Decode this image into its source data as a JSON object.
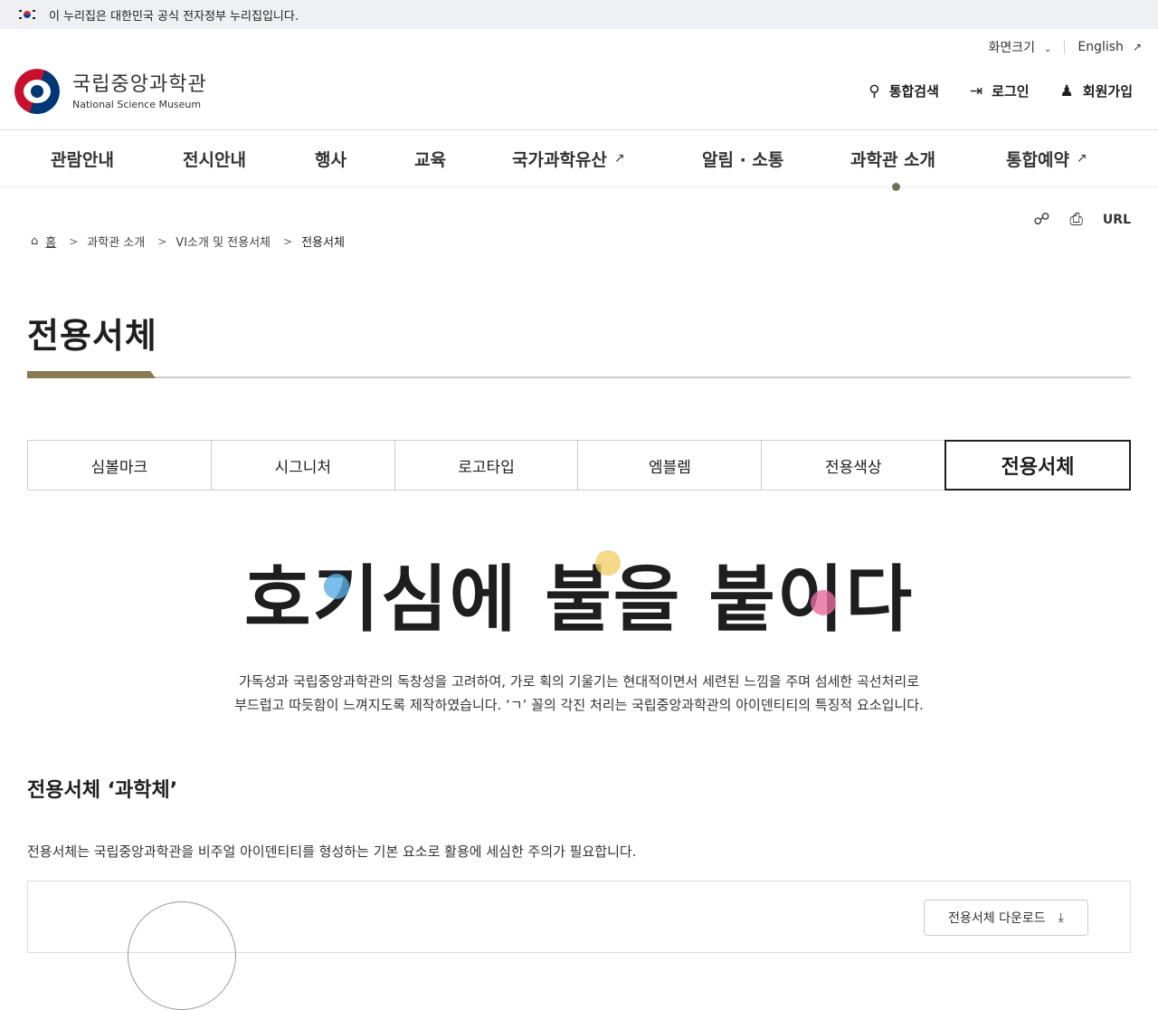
{
  "gov_banner": {
    "text": "이 누리집은 대한민국 공식 전자정부 누리집입니다."
  },
  "utility": {
    "font_size": "화면크기",
    "english": "English"
  },
  "logo": {
    "ko": "국립중앙과학관",
    "en": "National Science Museum"
  },
  "header_actions": {
    "search": "통합검색",
    "login": "로그인",
    "signup": "회원가입"
  },
  "nav": {
    "items": [
      {
        "label": "관람안내"
      },
      {
        "label": "전시안내"
      },
      {
        "label": "행사"
      },
      {
        "label": "교육"
      },
      {
        "label": "국가과학유산"
      },
      {
        "label": "알림 · 소통"
      },
      {
        "label": "과학관 소개"
      },
      {
        "label": "통합예약"
      }
    ]
  },
  "breadcrumb": {
    "home": "홈",
    "level1": "과학관 소개",
    "level2": "VI소개 및 전용서체",
    "current": "전용서체"
  },
  "tools": {
    "url": "URL"
  },
  "page_title": "전용서체",
  "tabs": [
    {
      "label": "심볼마크"
    },
    {
      "label": "시그니처"
    },
    {
      "label": "로고타입"
    },
    {
      "label": "엠블렘"
    },
    {
      "label": "전용색상"
    },
    {
      "label": "전용서체"
    }
  ],
  "slogan": "호기심에 불을 붙이다",
  "description": {
    "line1": "가독성과 국립중앙과학관의 독창성을 고려하여, 가로 획의 기울기는 현대적이면서 세련된 느낌을 주며 섬세한 곡선처리로",
    "line2": "부드럽고 따듯함이 느껴지도록 제작하였습니다. ‘ㄱ’ 꼴의 각진 처리는 국립중앙과학관의 아이덴티티의 특징적 요소입니다."
  },
  "section": {
    "title": "전용서체 ‘과학체’",
    "desc": "전용서체는 국립중앙과학관을 비주얼 아이덴티티를 형성하는 기본 요소로 활용에 세심한 주의가 필요합니다.",
    "download": "전용서체 다운로드"
  },
  "colors": {
    "accent_bar": "#8a7a52",
    "blob_blue": "#5aaee6",
    "blob_yellow": "#f2cf6a",
    "blob_pink": "#e36a9c"
  }
}
